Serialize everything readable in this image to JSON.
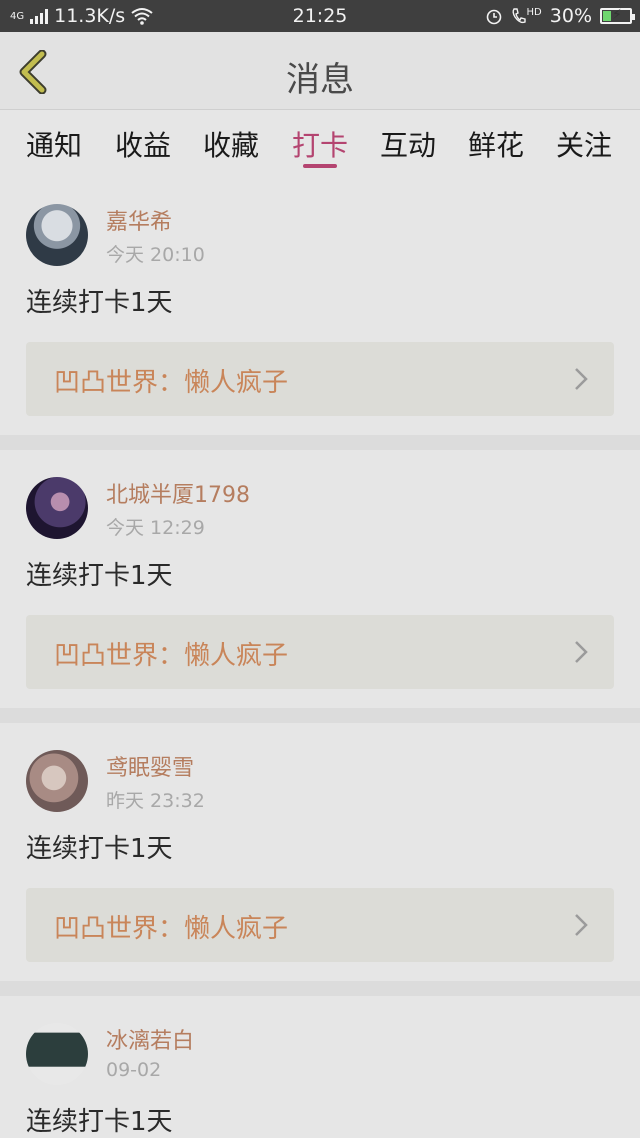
{
  "status_bar": {
    "network": "4G",
    "speed": "11.3K/s",
    "time": "21:25",
    "hd": "HD",
    "battery": "30%",
    "battery_level": 0.3
  },
  "header": {
    "title": "消息"
  },
  "tabs": [
    {
      "label": "通知"
    },
    {
      "label": "收益"
    },
    {
      "label": "收藏"
    },
    {
      "label": "打卡",
      "active": true
    },
    {
      "label": "互动"
    },
    {
      "label": "鲜花"
    },
    {
      "label": "关注"
    }
  ],
  "feed": [
    {
      "username": "嘉华希",
      "time": "今天 20:10",
      "message": "连续打卡1天",
      "link": "凹凸世界：懒人疯子"
    },
    {
      "username": "北城半厦1798",
      "time": "今天 12:29",
      "message": "连续打卡1天",
      "link": "凹凸世界：懒人疯子"
    },
    {
      "username": "鸢眠婴雪",
      "time": "昨天 23:32",
      "message": "连续打卡1天",
      "link": "凹凸世界：懒人疯子"
    },
    {
      "username": "冰漓若白",
      "time": "09-02",
      "message": "连续打卡1天",
      "link": ""
    }
  ],
  "colors": {
    "accent": "#b44470",
    "username": "#b57d5f",
    "link": "#c98559"
  }
}
